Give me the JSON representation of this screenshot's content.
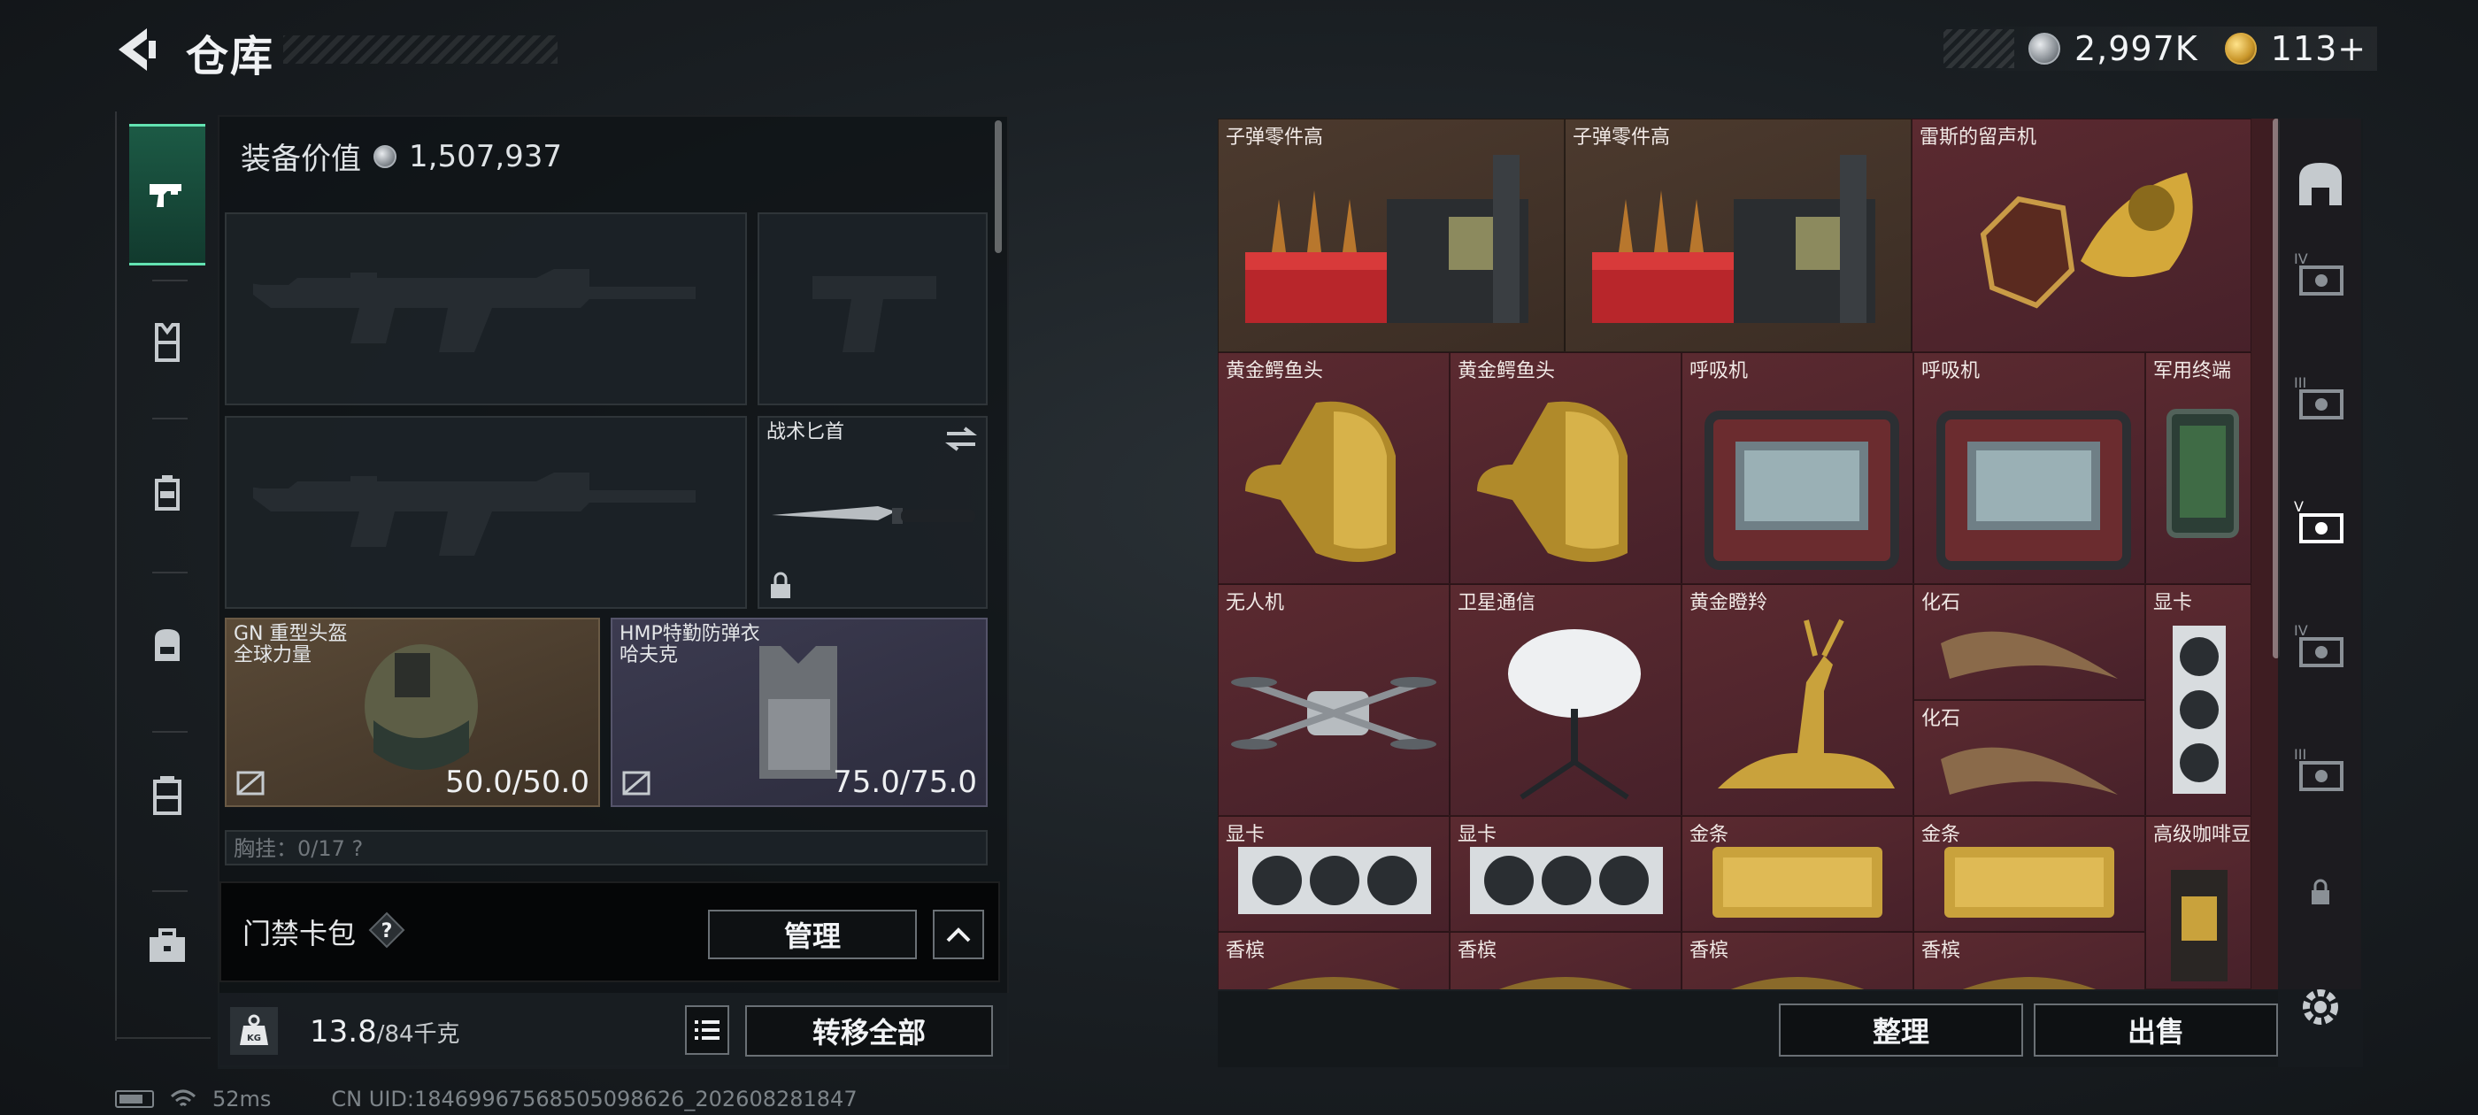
{
  "header": {
    "title": "仓库",
    "currency_silver": "2,997K",
    "currency_gold": "113+"
  },
  "rail": {
    "items": [
      {
        "icon": "pistol-icon",
        "active": true
      },
      {
        "icon": "vest-icon"
      },
      {
        "icon": "rig-icon"
      },
      {
        "icon": "backpack-icon"
      },
      {
        "icon": "case-icon"
      },
      {
        "icon": "briefcase-icon"
      }
    ]
  },
  "equipment": {
    "value_label": "装备价值",
    "value": "1,507,937",
    "melee_label": "战术匕首",
    "helmet": {
      "name": "GN 重型头盔",
      "sub": "全球力量",
      "durability": "50.0/50.0"
    },
    "armor": {
      "name": "HMP特勤防弹衣",
      "sub": "哈夫克",
      "durability": "75.0/75.0"
    },
    "chest_partial": "胸挂：0/17  ?"
  },
  "keycard": {
    "label": "门禁卡包",
    "help": "?",
    "manage": "管理"
  },
  "weight": {
    "current": "13.8",
    "max": "/84千克",
    "transfer_all": "转移全部"
  },
  "status": {
    "ping": "52ms",
    "uid": "CN UID:18469967568505098626_202608281847"
  },
  "inventory": {
    "items": [
      {
        "name": "子弹零件高",
        "kind": "ammo-crate"
      },
      {
        "name": "子弹零件高",
        "kind": "ammo-crate"
      },
      {
        "name": "雷斯的留声机",
        "kind": "gramophone"
      },
      {
        "name": "黄金鳄鱼头",
        "kind": "croc-head"
      },
      {
        "name": "黄金鳄鱼头",
        "kind": "croc-head"
      },
      {
        "name": "呼吸机",
        "kind": "ventilator"
      },
      {
        "name": "呼吸机",
        "kind": "ventilator"
      },
      {
        "name": "军用终端",
        "kind": "terminal"
      },
      {
        "name": "无人机",
        "kind": "drone"
      },
      {
        "name": "卫星通信",
        "kind": "satellite"
      },
      {
        "name": "黄金瞪羚",
        "kind": "gazelle"
      },
      {
        "name": "化石",
        "kind": "fossil"
      },
      {
        "name": "化石",
        "kind": "fossil"
      },
      {
        "name": "显卡",
        "kind": "gpu-vertical"
      },
      {
        "name": "显卡",
        "kind": "gpu"
      },
      {
        "name": "显卡",
        "kind": "gpu"
      },
      {
        "name": "金条",
        "kind": "gold-bar"
      },
      {
        "name": "金条",
        "kind": "gold-bar"
      },
      {
        "name": "高级咖啡豆",
        "kind": "coffee"
      },
      {
        "name": "香槟",
        "kind": "champagne"
      },
      {
        "name": "香槟",
        "kind": "champagne"
      },
      {
        "name": "香槟",
        "kind": "champagne"
      },
      {
        "name": "香槟",
        "kind": "champagne"
      }
    ],
    "sort": "整理",
    "sell": "出售"
  },
  "right_tabs": [
    {
      "icon": "vault-icon"
    },
    {
      "icon": "tier-4-case-icon",
      "tier": "IV"
    },
    {
      "icon": "tier-3-case-icon",
      "tier": "III"
    },
    {
      "icon": "tier-5-case-icon",
      "tier": "V",
      "active": true
    },
    {
      "icon": "tier-4-case-icon",
      "tier": "IV"
    },
    {
      "icon": "tier-3-case-icon",
      "tier": "III"
    },
    {
      "icon": "lock-icon"
    }
  ],
  "colors": {
    "accent": "#63e3b2",
    "cell_red": "#5b2a30",
    "cell_brown": "#4c3a2e",
    "gold": "#d9aa40"
  }
}
